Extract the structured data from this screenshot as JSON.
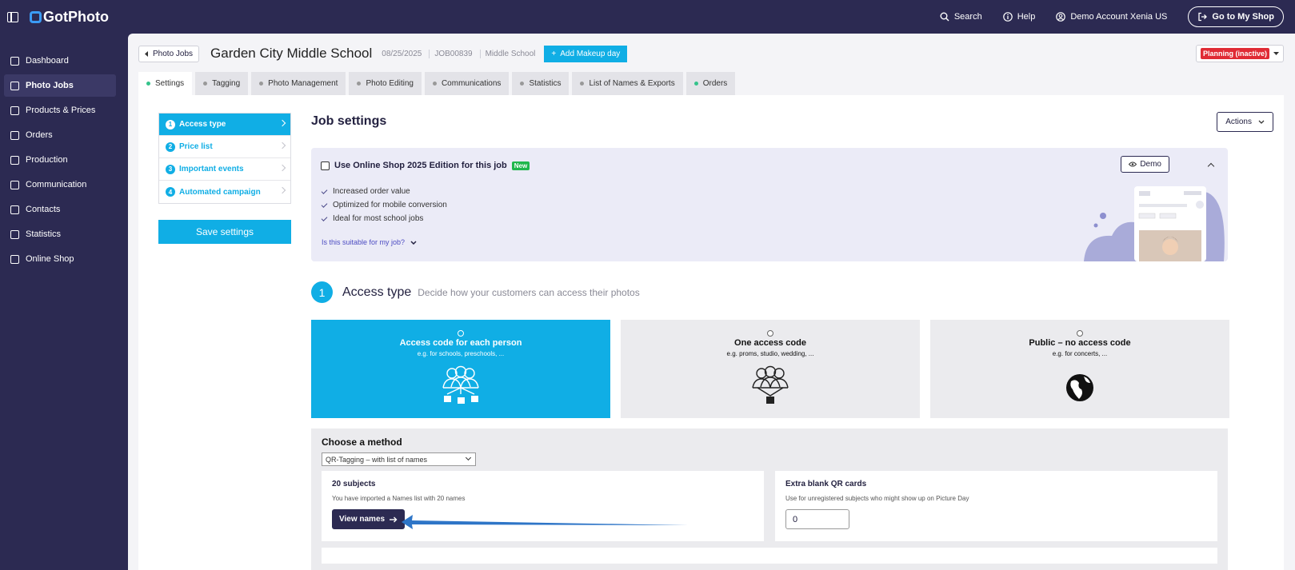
{
  "app": {
    "brand": "GotPhoto",
    "top_links": {
      "search": "Search",
      "help": "Help",
      "account": "Demo Account Xenia US",
      "shop": "Go to My Shop"
    }
  },
  "sidebar": {
    "items": [
      {
        "label": "Dashboard"
      },
      {
        "label": "Photo Jobs"
      },
      {
        "label": "Products & Prices"
      },
      {
        "label": "Orders"
      },
      {
        "label": "Production"
      },
      {
        "label": "Communication"
      },
      {
        "label": "Contacts"
      },
      {
        "label": "Statistics"
      },
      {
        "label": "Online Shop"
      }
    ]
  },
  "job": {
    "back": "Photo Jobs",
    "title": "Garden City Middle School",
    "date": "08/25/2025",
    "id": "JOB00839",
    "type": "Middle School",
    "makeup": "Add Makeup day",
    "status": "Planning (inactive)"
  },
  "tabs": [
    "Settings",
    "Tagging",
    "Photo Management",
    "Photo Editing",
    "Communications",
    "Statistics",
    "List of Names & Exports",
    "Orders"
  ],
  "steps": [
    {
      "num": "1",
      "label": "Access type"
    },
    {
      "num": "2",
      "label": "Price list"
    },
    {
      "num": "3",
      "label": "Important events"
    },
    {
      "num": "4",
      "label": "Automated campaign"
    }
  ],
  "save_label": "Save settings",
  "settings_title": "Job settings",
  "actions_label": "Actions",
  "promo": {
    "checkbox_label": "Use Online Shop 2025 Edition for this job",
    "badge": "New",
    "benefits": [
      "Increased order value",
      "Optimized for mobile conversion",
      "Ideal for most school jobs"
    ],
    "suitable": "Is this suitable for my job?",
    "demo": "Demo"
  },
  "access": {
    "num": "1",
    "title": "Access type",
    "subtitle": "Decide how your customers can access their photos",
    "options": [
      {
        "title": "Access code for each person",
        "sub": "e.g. for schools, preschools, ..."
      },
      {
        "title": "One access code",
        "sub": "e.g. proms, studio, wedding, ..."
      },
      {
        "title": "Public – no access code",
        "sub": "e.g. for concerts, ..."
      }
    ]
  },
  "method": {
    "title": "Choose a method",
    "selected": "QR-Tagging – with list of names",
    "subjects_title": "20 subjects",
    "subjects_desc": "You have imported a Names list with 20 names",
    "view_names": "View names",
    "qr_title": "Extra blank QR cards",
    "qr_desc": "Use for unregistered subjects who might show up on Picture Day",
    "qr_value": "0"
  },
  "colors": {
    "brand": "#2c2a52",
    "accent": "#10aee5",
    "status": "#e02b35",
    "new": "#20b74c"
  }
}
